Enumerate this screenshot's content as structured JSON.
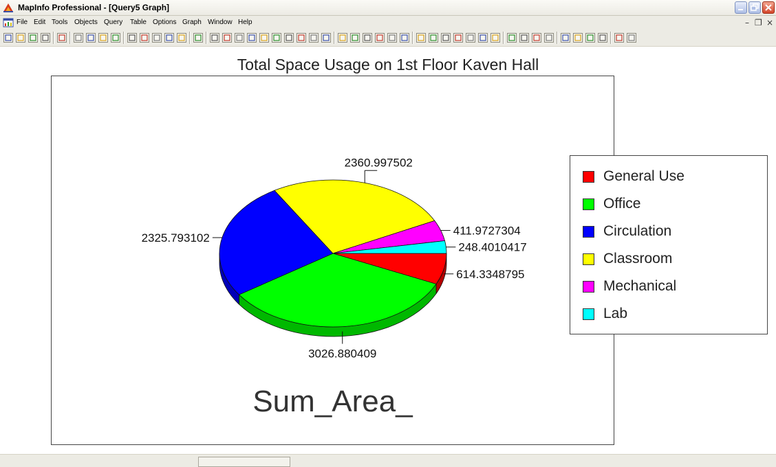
{
  "window": {
    "title": "MapInfo Professional - [Query5 Graph]",
    "app_icon": "mapinfo-icon"
  },
  "menubar": {
    "items": [
      "File",
      "Edit",
      "Tools",
      "Objects",
      "Query",
      "Table",
      "Options",
      "Graph",
      "Window",
      "Help"
    ],
    "doc_icon": "graph-document-icon"
  },
  "toolbar": {
    "icons": [
      "new-icon",
      "open-icon",
      "open-workspace-icon",
      "save-icon",
      "print-icon",
      "cut-icon",
      "copy-icon",
      "paste-icon",
      "undo-icon",
      "new-browser-icon",
      "new-mapper-icon",
      "new-grapher-icon",
      "new-layout-icon",
      "new-redistrict-icon",
      "help-pointer-icon",
      "select-icon",
      "line-icon",
      "polyline-icon",
      "arc-icon",
      "polygon-icon",
      "ellipse-icon",
      "rectangle-icon",
      "rounded-rect-icon",
      "text-icon",
      "frame-icon",
      "reshape-icon",
      "add-node-icon",
      "symbol-style-icon",
      "line-style-icon",
      "region-style-icon",
      "text-style-icon",
      "arrow-select-icon",
      "marquee-select-icon",
      "radius-select-icon",
      "polygon-select-icon",
      "boundary-select-icon",
      "unselect-icon",
      "graph-select-icon",
      "zoom-in-icon",
      "zoom-out-icon",
      "change-view-icon",
      "grabber-icon",
      "info-icon",
      "ruler-icon",
      "drag-window-icon",
      "label-icon",
      "layer-control-icon",
      "show-legend-icon"
    ]
  },
  "chart_data": {
    "type": "pie",
    "title": "Total Space Usage on 1st Floor Kaven Hall",
    "series_label": "Sum_Area_",
    "legend_position": "right",
    "slices": [
      {
        "category": "General Use",
        "value": 614.3348795,
        "label": "614.3348795",
        "color": "#ff0000"
      },
      {
        "category": "Office",
        "value": 3026.880409,
        "label": "3026.880409",
        "color": "#00ff00"
      },
      {
        "category": "Circulation",
        "value": 2325.793102,
        "label": "2325.793102",
        "color": "#0000ff"
      },
      {
        "category": "Classroom",
        "value": 2360.997502,
        "label": "2360.997502",
        "color": "#ffff00"
      },
      {
        "category": "Mechanical",
        "value": 411.9727304,
        "label": "411.9727304",
        "color": "#ff00ff"
      },
      {
        "category": "Lab",
        "value": 248.4010417,
        "label": "248.4010417",
        "color": "#00ffff"
      }
    ]
  }
}
